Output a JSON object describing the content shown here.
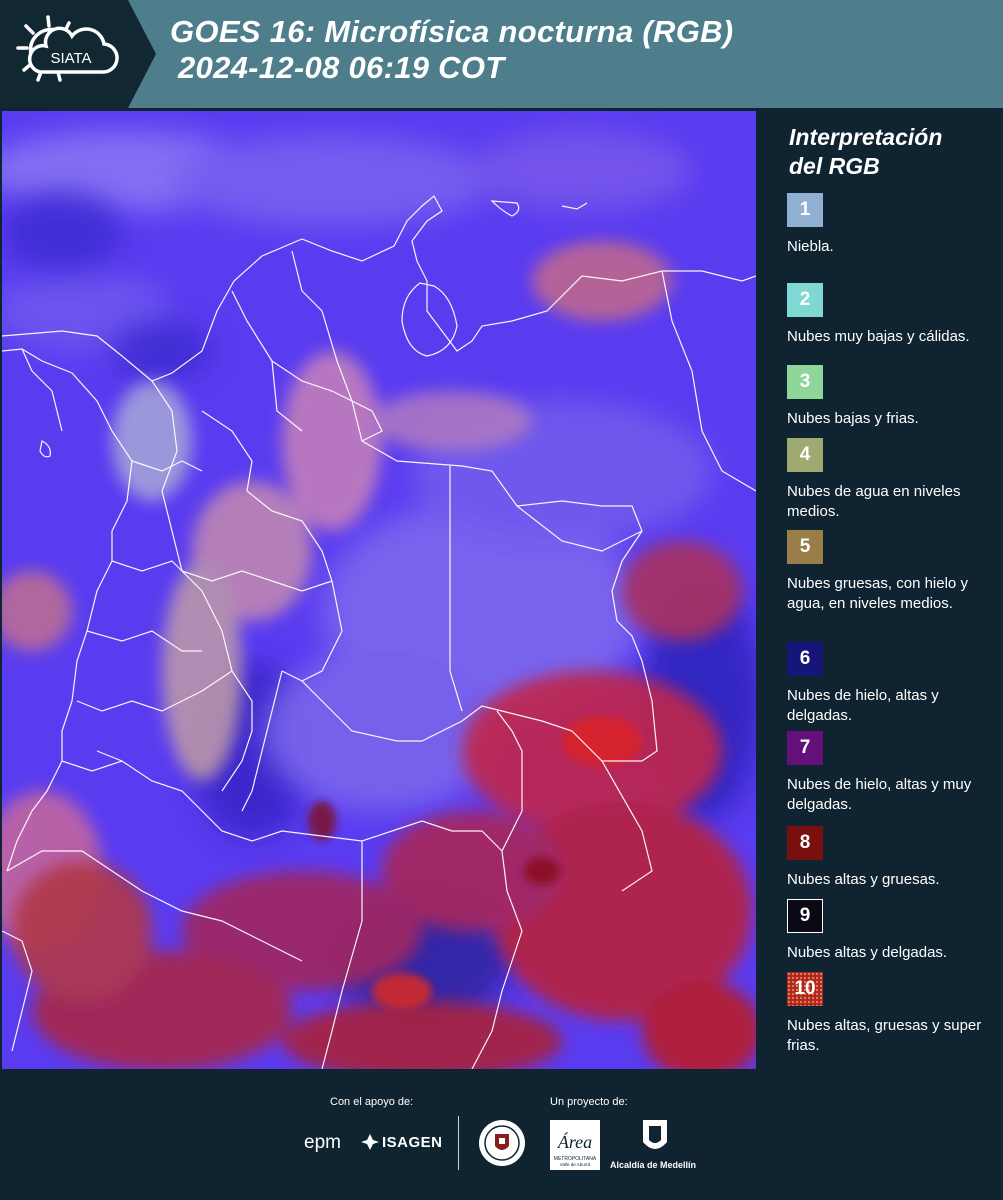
{
  "header": {
    "logo_text": "SIATA",
    "title_line1": "GOES 16: Microfísica nocturna (RGB)",
    "title_line2": "2024-12-08 06:19 COT"
  },
  "map": {
    "background_color": "#5a3cf0",
    "icon": "satellite-rgb-composite"
  },
  "legend": {
    "title_line1": "Interpretación",
    "title_line2": "del RGB",
    "items": [
      {
        "number": "1",
        "color": "#8fb0d0",
        "label": "Niebla."
      },
      {
        "number": "2",
        "color": "#7fd8d4",
        "label": "Nubes muy bajas y cálidas."
      },
      {
        "number": "3",
        "color": "#8ed69a",
        "label": "Nubes bajas y frias."
      },
      {
        "number": "4",
        "color": "#9faa72",
        "label": "Nubes de agua en niveles medios."
      },
      {
        "number": "5",
        "color": "#9a7e4a",
        "label": "Nubes gruesas, con hielo y agua, en niveles medios."
      },
      {
        "number": "6",
        "color": "#16157a",
        "label": "Nubes de hielo, altas y delgadas."
      },
      {
        "number": "7",
        "color": "#640f7a",
        "label": "Nubes de hielo, altas y muy delgadas."
      },
      {
        "number": "8",
        "color": "#7a0f0f",
        "label": "Nubes altas y gruesas."
      },
      {
        "number": "9",
        "color": "#0a0a14",
        "label": "Nubes altas y delgadas."
      },
      {
        "number": "10",
        "color": "#b02818",
        "label": "Nubes altas, gruesas y super frias."
      }
    ]
  },
  "footer": {
    "support_label": "Con el apoyo de:",
    "project_label": "Un proyecto de:",
    "sponsor1": "epm",
    "sponsor2": "ISAGEN",
    "partner1_label": "Área",
    "partner1_sub": "METROPOLITANA",
    "partner1_sub2": "Valle de Aburrá",
    "partner2_label": "Alcaldía de Medellín"
  }
}
